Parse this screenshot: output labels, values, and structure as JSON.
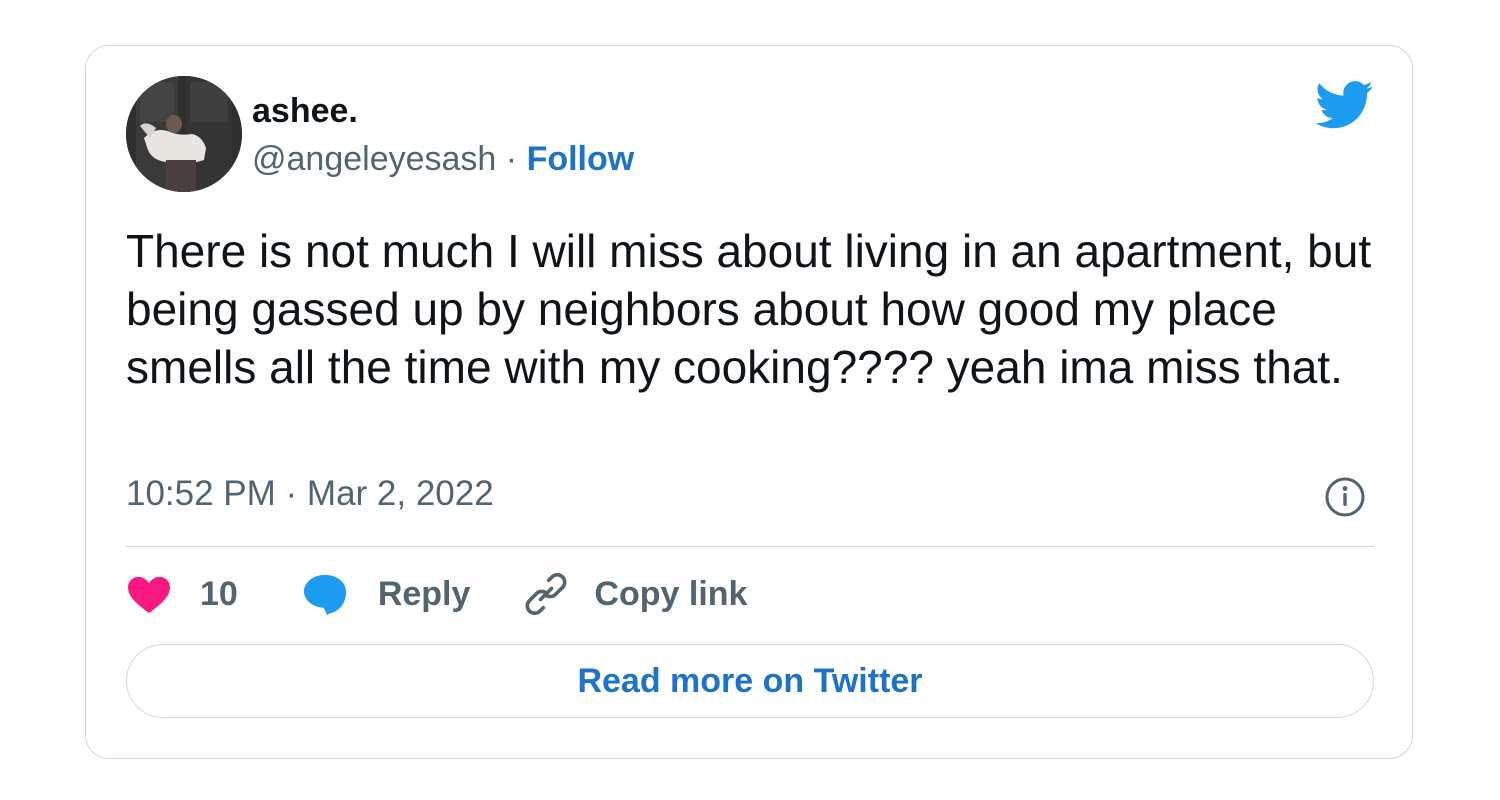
{
  "author": {
    "name": "ashee.",
    "handle": "@angeleyesash",
    "separator": "·",
    "follow_label": "Follow",
    "avatar_icon": "profile-photo"
  },
  "tweet": {
    "text": "There is not much I will miss about living in an apartment, but being gassed up by neighbors about how good my place smells all the time with my cooking???? yeah ima miss that.",
    "timestamp": "10:52 PM · Mar 2, 2022"
  },
  "actions": {
    "like_count": "10",
    "reply_label": "Reply",
    "copy_label": "Copy link"
  },
  "footer": {
    "read_more_label": "Read more on Twitter"
  },
  "icons": {
    "brand": "twitter-bird-icon",
    "info": "info-icon",
    "like": "heart-icon",
    "reply": "speech-bubble-icon",
    "copy": "link-icon"
  },
  "colors": {
    "twitter_blue": "#1d9bf0",
    "link_blue": "#1d72c9",
    "like_pink": "#f91880",
    "text_primary": "#0f1419",
    "text_secondary": "#536471",
    "border": "#cfd9de"
  }
}
